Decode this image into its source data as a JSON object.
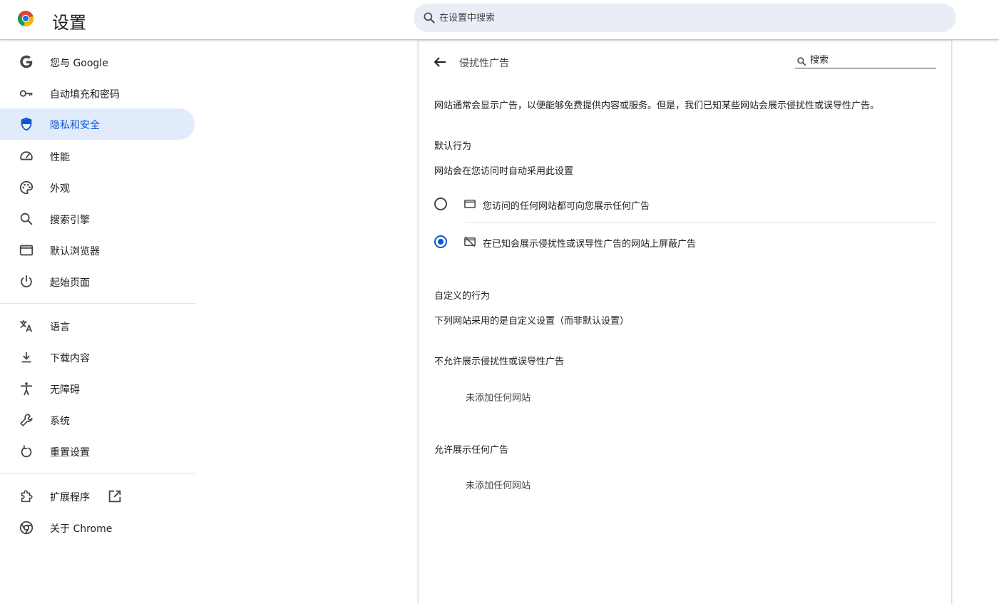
{
  "header": {
    "title": "设置",
    "search_placeholder": "在设置中搜索",
    "logo_icon": "chrome-logo-icon",
    "search_icon": "search-icon"
  },
  "sidebar": {
    "items": [
      {
        "label": "您与 Google",
        "icon": "google-g-icon",
        "active": false
      },
      {
        "label": "自动填充和密码",
        "icon": "key-icon",
        "active": false
      },
      {
        "label": "隐私和安全",
        "icon": "shield-icon",
        "active": true
      },
      {
        "label": "性能",
        "icon": "speedometer-icon",
        "active": false
      },
      {
        "label": "外观",
        "icon": "palette-icon",
        "active": false
      },
      {
        "label": "搜索引擎",
        "icon": "search-icon",
        "active": false
      },
      {
        "label": "默认浏览器",
        "icon": "browser-window-icon",
        "active": false
      },
      {
        "label": "起始页面",
        "icon": "power-icon",
        "active": false
      },
      {
        "label": "语言",
        "icon": "translate-icon",
        "active": false
      },
      {
        "label": "下载内容",
        "icon": "download-icon",
        "active": false
      },
      {
        "label": "无障碍",
        "icon": "accessibility-icon",
        "active": false
      },
      {
        "label": "系统",
        "icon": "wrench-icon",
        "active": false
      },
      {
        "label": "重置设置",
        "icon": "reset-icon",
        "active": false
      },
      {
        "label": "扩展程序",
        "icon": "puzzle-icon",
        "active": false
      },
      {
        "label": "关于 Chrome",
        "icon": "chrome-icon",
        "active": false
      }
    ],
    "extensions_link_icon": "open-in-new-icon"
  },
  "main": {
    "page_title": "侵扰性广告",
    "search_placeholder": "搜索",
    "description": "网站通常会显示广告，以便能够免费提供内容或服务。但是，我们已知某些网站会展示侵扰性或误导性广告。",
    "default_behavior": {
      "heading": "默认行为",
      "subheading": "网站会在您访问时自动采用此设置",
      "options": [
        {
          "label": "您访问的任何网站都可向您展示任何广告",
          "icon": "browser-window-icon",
          "checked": false
        },
        {
          "label": "在已知会展示侵扰性或误导性广告的网站上屏蔽广告",
          "icon": "ads-blocked-icon",
          "checked": true
        }
      ]
    },
    "custom_behavior": {
      "heading": "自定义的行为",
      "subheading": "下列网站采用的是自定义设置（而非默认设置）",
      "block_list": {
        "heading": "不允许展示侵扰性或误导性广告",
        "empty_text": "未添加任何网站"
      },
      "allow_list": {
        "heading": "允许展示任何广告",
        "empty_text": "未添加任何网站"
      }
    }
  }
}
